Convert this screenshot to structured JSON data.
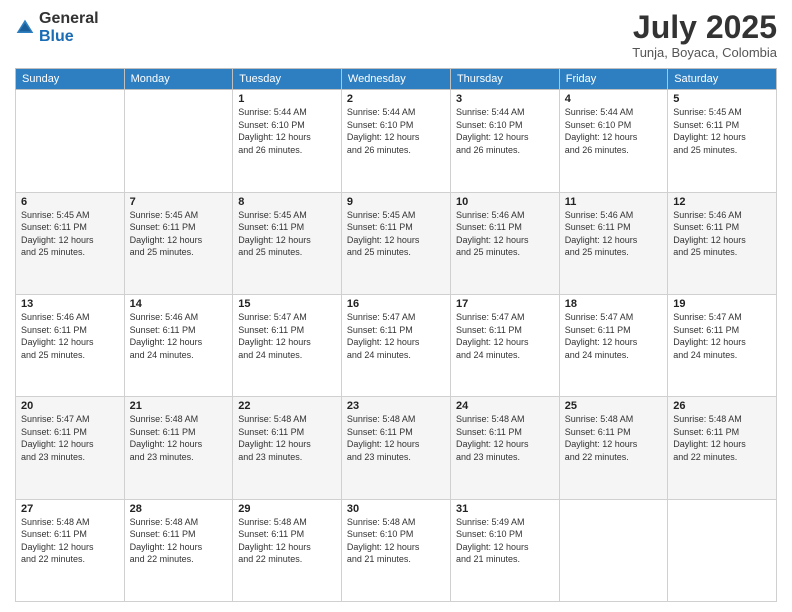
{
  "header": {
    "logo_general": "General",
    "logo_blue": "Blue",
    "month_title": "July 2025",
    "location": "Tunja, Boyaca, Colombia"
  },
  "calendar": {
    "headers": [
      "Sunday",
      "Monday",
      "Tuesday",
      "Wednesday",
      "Thursday",
      "Friday",
      "Saturday"
    ],
    "weeks": [
      [
        {
          "day": "",
          "info": ""
        },
        {
          "day": "",
          "info": ""
        },
        {
          "day": "1",
          "info": "Sunrise: 5:44 AM\nSunset: 6:10 PM\nDaylight: 12 hours\nand 26 minutes."
        },
        {
          "day": "2",
          "info": "Sunrise: 5:44 AM\nSunset: 6:10 PM\nDaylight: 12 hours\nand 26 minutes."
        },
        {
          "day": "3",
          "info": "Sunrise: 5:44 AM\nSunset: 6:10 PM\nDaylight: 12 hours\nand 26 minutes."
        },
        {
          "day": "4",
          "info": "Sunrise: 5:44 AM\nSunset: 6:10 PM\nDaylight: 12 hours\nand 26 minutes."
        },
        {
          "day": "5",
          "info": "Sunrise: 5:45 AM\nSunset: 6:11 PM\nDaylight: 12 hours\nand 25 minutes."
        }
      ],
      [
        {
          "day": "6",
          "info": "Sunrise: 5:45 AM\nSunset: 6:11 PM\nDaylight: 12 hours\nand 25 minutes."
        },
        {
          "day": "7",
          "info": "Sunrise: 5:45 AM\nSunset: 6:11 PM\nDaylight: 12 hours\nand 25 minutes."
        },
        {
          "day": "8",
          "info": "Sunrise: 5:45 AM\nSunset: 6:11 PM\nDaylight: 12 hours\nand 25 minutes."
        },
        {
          "day": "9",
          "info": "Sunrise: 5:45 AM\nSunset: 6:11 PM\nDaylight: 12 hours\nand 25 minutes."
        },
        {
          "day": "10",
          "info": "Sunrise: 5:46 AM\nSunset: 6:11 PM\nDaylight: 12 hours\nand 25 minutes."
        },
        {
          "day": "11",
          "info": "Sunrise: 5:46 AM\nSunset: 6:11 PM\nDaylight: 12 hours\nand 25 minutes."
        },
        {
          "day": "12",
          "info": "Sunrise: 5:46 AM\nSunset: 6:11 PM\nDaylight: 12 hours\nand 25 minutes."
        }
      ],
      [
        {
          "day": "13",
          "info": "Sunrise: 5:46 AM\nSunset: 6:11 PM\nDaylight: 12 hours\nand 25 minutes."
        },
        {
          "day": "14",
          "info": "Sunrise: 5:46 AM\nSunset: 6:11 PM\nDaylight: 12 hours\nand 24 minutes."
        },
        {
          "day": "15",
          "info": "Sunrise: 5:47 AM\nSunset: 6:11 PM\nDaylight: 12 hours\nand 24 minutes."
        },
        {
          "day": "16",
          "info": "Sunrise: 5:47 AM\nSunset: 6:11 PM\nDaylight: 12 hours\nand 24 minutes."
        },
        {
          "day": "17",
          "info": "Sunrise: 5:47 AM\nSunset: 6:11 PM\nDaylight: 12 hours\nand 24 minutes."
        },
        {
          "day": "18",
          "info": "Sunrise: 5:47 AM\nSunset: 6:11 PM\nDaylight: 12 hours\nand 24 minutes."
        },
        {
          "day": "19",
          "info": "Sunrise: 5:47 AM\nSunset: 6:11 PM\nDaylight: 12 hours\nand 24 minutes."
        }
      ],
      [
        {
          "day": "20",
          "info": "Sunrise: 5:47 AM\nSunset: 6:11 PM\nDaylight: 12 hours\nand 23 minutes."
        },
        {
          "day": "21",
          "info": "Sunrise: 5:48 AM\nSunset: 6:11 PM\nDaylight: 12 hours\nand 23 minutes."
        },
        {
          "day": "22",
          "info": "Sunrise: 5:48 AM\nSunset: 6:11 PM\nDaylight: 12 hours\nand 23 minutes."
        },
        {
          "day": "23",
          "info": "Sunrise: 5:48 AM\nSunset: 6:11 PM\nDaylight: 12 hours\nand 23 minutes."
        },
        {
          "day": "24",
          "info": "Sunrise: 5:48 AM\nSunset: 6:11 PM\nDaylight: 12 hours\nand 23 minutes."
        },
        {
          "day": "25",
          "info": "Sunrise: 5:48 AM\nSunset: 6:11 PM\nDaylight: 12 hours\nand 22 minutes."
        },
        {
          "day": "26",
          "info": "Sunrise: 5:48 AM\nSunset: 6:11 PM\nDaylight: 12 hours\nand 22 minutes."
        }
      ],
      [
        {
          "day": "27",
          "info": "Sunrise: 5:48 AM\nSunset: 6:11 PM\nDaylight: 12 hours\nand 22 minutes."
        },
        {
          "day": "28",
          "info": "Sunrise: 5:48 AM\nSunset: 6:11 PM\nDaylight: 12 hours\nand 22 minutes."
        },
        {
          "day": "29",
          "info": "Sunrise: 5:48 AM\nSunset: 6:11 PM\nDaylight: 12 hours\nand 22 minutes."
        },
        {
          "day": "30",
          "info": "Sunrise: 5:48 AM\nSunset: 6:10 PM\nDaylight: 12 hours\nand 21 minutes."
        },
        {
          "day": "31",
          "info": "Sunrise: 5:49 AM\nSunset: 6:10 PM\nDaylight: 12 hours\nand 21 minutes."
        },
        {
          "day": "",
          "info": ""
        },
        {
          "day": "",
          "info": ""
        }
      ]
    ]
  }
}
